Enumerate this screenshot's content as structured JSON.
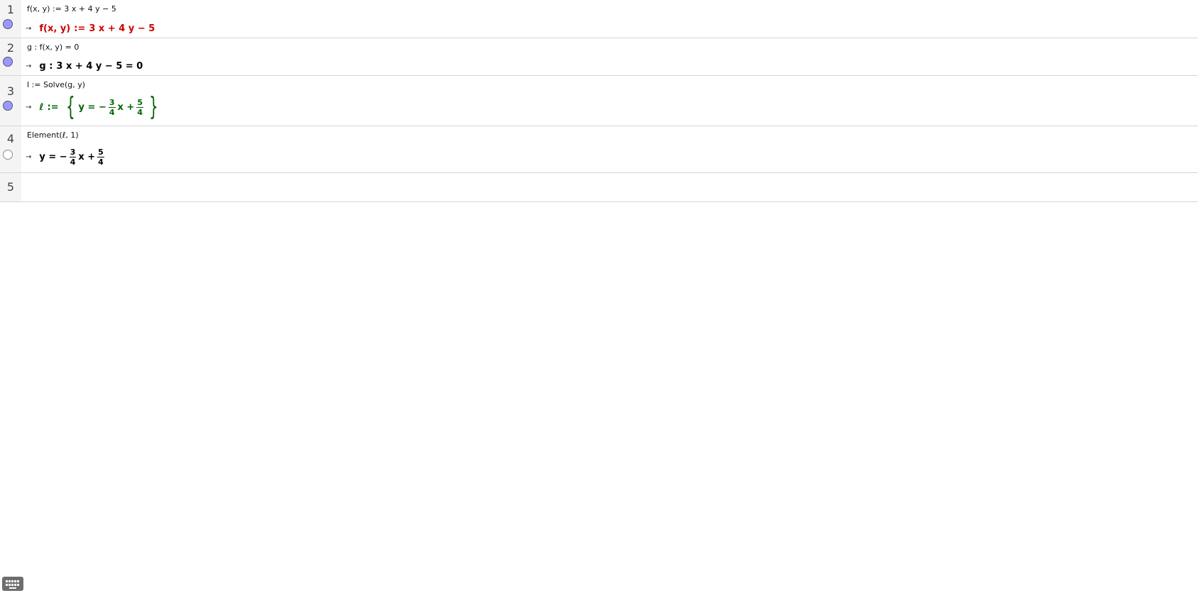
{
  "rows": [
    {
      "number": "1",
      "toggle": "on",
      "input": "f(x, y) := 3 x + 4 y − 5",
      "output": {
        "lhs": "f(x, y)",
        "op": ":=",
        "rhs": "3 x + 4 y − 5"
      }
    },
    {
      "number": "2",
      "toggle": "on",
      "input": "g : f(x, y) = 0",
      "output": {
        "lhs": "g :",
        "rhs": "3 x + 4 y − 5 = 0"
      }
    },
    {
      "number": "3",
      "toggle": "on",
      "input": "l := Solve(g, y)",
      "output": {
        "lhs": "ℓ",
        "op": ":=",
        "open_brace": "{",
        "term1": "y = −",
        "frac1_num": "3",
        "frac1_den": "4",
        "term2": "x +",
        "frac2_num": "5",
        "frac2_den": "4",
        "close_brace": "}"
      }
    },
    {
      "number": "4",
      "toggle": "off",
      "input": "Element(ℓ, 1)",
      "output": {
        "term1": "y = −",
        "frac1_num": "3",
        "frac1_den": "4",
        "term2": "x +",
        "frac2_num": "5",
        "frac2_den": "4"
      }
    },
    {
      "number": "5",
      "input": ""
    }
  ],
  "arrow_glyph": "→",
  "colors": {
    "row1_output": "#cc0000",
    "row3_output": "#006400",
    "toggle_on": "#9999ff"
  },
  "keyboard_icon": "keyboard-icon"
}
